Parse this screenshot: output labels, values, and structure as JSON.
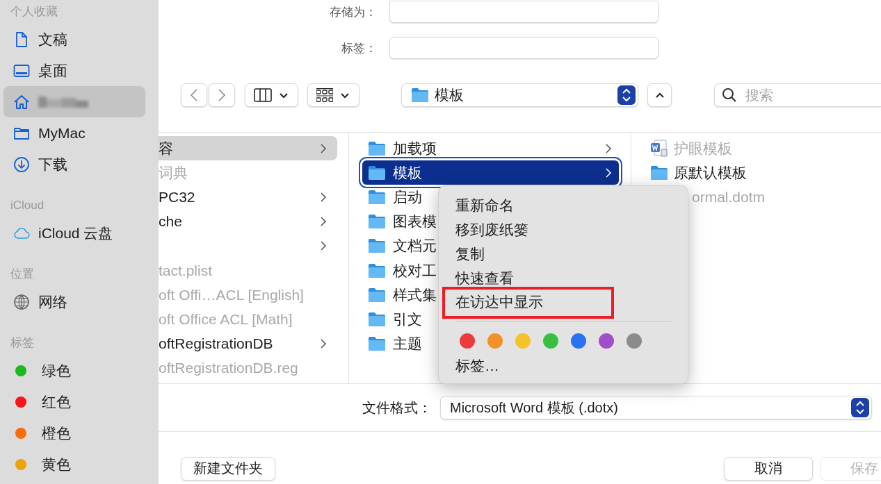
{
  "sidebar": {
    "sections": [
      {
        "title": "个人收藏",
        "items": [
          {
            "kind": "document",
            "label": "文稿",
            "selected": false
          },
          {
            "kind": "desktop",
            "label": "桌面",
            "selected": false
          },
          {
            "kind": "home",
            "selected": true
          },
          {
            "kind": "folder",
            "label": "MyMac",
            "selected": false
          },
          {
            "kind": "download",
            "label": "下载",
            "selected": false
          }
        ]
      },
      {
        "title": "iCloud",
        "items": [
          {
            "kind": "cloud",
            "label": "iCloud 云盘",
            "selected": false
          }
        ]
      },
      {
        "title": "位置",
        "items": [
          {
            "kind": "globe",
            "label": "网络",
            "selected": false
          }
        ]
      },
      {
        "title": "标签",
        "items": [
          {
            "kind": "tag",
            "color": "#1cb81c",
            "label": "绿色",
            "selected": false
          },
          {
            "kind": "tag",
            "color": "#f9131b",
            "label": "红色",
            "selected": false
          },
          {
            "kind": "tag",
            "color": "#f76c07",
            "label": "橙色",
            "selected": false
          },
          {
            "kind": "tag",
            "color": "#eda20a",
            "label": "黄色",
            "selected": false
          }
        ]
      }
    ]
  },
  "save_form": {
    "save_as_label": "存储为：",
    "tags_label": "标签："
  },
  "toolbar": {
    "location": "模板",
    "search": {
      "placeholder": "搜索"
    }
  },
  "browser": {
    "columns": [
      {
        "items": [
          {
            "name": "容",
            "selected": true,
            "greyed": false,
            "has_children": true
          },
          {
            "name": "词典",
            "selected": false,
            "greyed": true,
            "has_children": false
          },
          {
            "name": "PC32",
            "selected": false,
            "greyed": false,
            "has_children": true
          },
          {
            "name": "che",
            "selected": false,
            "greyed": false,
            "has_children": true
          },
          {
            "selected": false,
            "greyed": false,
            "has_children": true
          },
          {
            "name": "tact.plist",
            "selected": false,
            "greyed": true,
            "has_children": false
          },
          {
            "name": "oft Offi…ACL [English]",
            "selected": false,
            "greyed": true,
            "has_children": false
          },
          {
            "name": "oft Office ACL [Math]",
            "selected": false,
            "greyed": true,
            "has_children": false
          },
          {
            "name": "oftRegistrationDB",
            "selected": false,
            "greyed": false,
            "has_children": true
          },
          {
            "name": "oftRegistrationDB.reg",
            "selected": false,
            "greyed": true,
            "has_children": false
          }
        ]
      },
      {
        "items": [
          {
            "kind": "folder",
            "name": "加载项",
            "selected": false,
            "greyed": false,
            "has_children": true
          },
          {
            "kind": "folder",
            "name": "模板",
            "selected": true,
            "greyed": false,
            "has_children": true
          },
          {
            "kind": "folder",
            "name": "启动",
            "selected": false,
            "greyed": false
          },
          {
            "kind": "folder",
            "name": "图表模",
            "selected": false,
            "greyed": false
          },
          {
            "kind": "folder",
            "name": "文档元",
            "selected": false,
            "greyed": false
          },
          {
            "kind": "folder",
            "name": "校对工",
            "selected": false,
            "greyed": false
          },
          {
            "kind": "folder",
            "name": "样式集",
            "selected": false,
            "greyed": false
          },
          {
            "kind": "folder",
            "name": "引文",
            "selected": false,
            "greyed": false
          },
          {
            "kind": "folder",
            "name": "主题",
            "selected": false,
            "greyed": false
          }
        ]
      },
      {
        "items": [
          {
            "kind": "word",
            "name": "护眼模板",
            "selected": false,
            "greyed": true,
            "has_children": false
          },
          {
            "kind": "folder",
            "name": "原默认模板",
            "selected": false,
            "greyed": false,
            "has_children": false
          },
          {
            "kind": "covered",
            "name": "ormal.dotm",
            "selected": false,
            "greyed": true,
            "has_children": false
          }
        ]
      }
    ]
  },
  "context_menu": {
    "items": [
      {
        "label": "重新命名",
        "highlighted": false
      },
      {
        "label": "移到废纸篓",
        "highlighted": false
      },
      {
        "label": "复制",
        "highlighted": false
      },
      {
        "label": "快速查看",
        "highlighted": false
      },
      {
        "label": "在访达中显示",
        "highlighted": true
      }
    ],
    "tag_colors": [
      {
        "color": "#ee3a3a"
      },
      {
        "color": "#f19127"
      },
      {
        "color": "#f4c327"
      },
      {
        "color": "#37c03f"
      },
      {
        "color": "#2872f5"
      },
      {
        "color": "#a14ecb"
      },
      {
        "color": "#8b8b8e"
      }
    ],
    "tags_item": "标签…"
  },
  "format": {
    "label": "文件格式：",
    "value": "Microsoft Word 模板 (.dotx)"
  },
  "buttons": [
    {
      "kind": "left",
      "label": "新建文件夹",
      "disabled": false
    },
    {
      "kind": "right",
      "label": "取消",
      "disabled": false
    },
    {
      "kind": "right",
      "label": "保存",
      "disabled": true
    }
  ]
}
